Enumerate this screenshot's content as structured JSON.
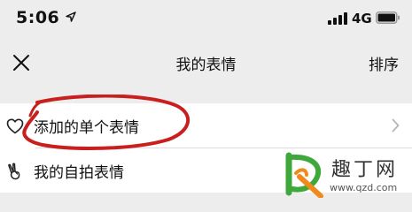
{
  "status_bar": {
    "time": "5:06",
    "network": "4G",
    "icons": [
      "location-arrow-icon",
      "signal-bars-icon",
      "battery-icon"
    ]
  },
  "nav": {
    "title": "我的表情",
    "sort_label": "排序",
    "close_icon": "close-icon"
  },
  "list": {
    "items": [
      {
        "icon": "heart-icon",
        "label": "添加的单个表情",
        "has_chevron": true
      },
      {
        "icon": "victory-hand-icon",
        "label": "我的自拍表情",
        "has_chevron": false
      }
    ]
  },
  "annotation": {
    "color": "#c8201e"
  },
  "watermark": {
    "brand": "趣丁网",
    "url": "www.qzd.com",
    "colors": {
      "green": "#3ea83a",
      "orange": "#f08a1c"
    }
  }
}
